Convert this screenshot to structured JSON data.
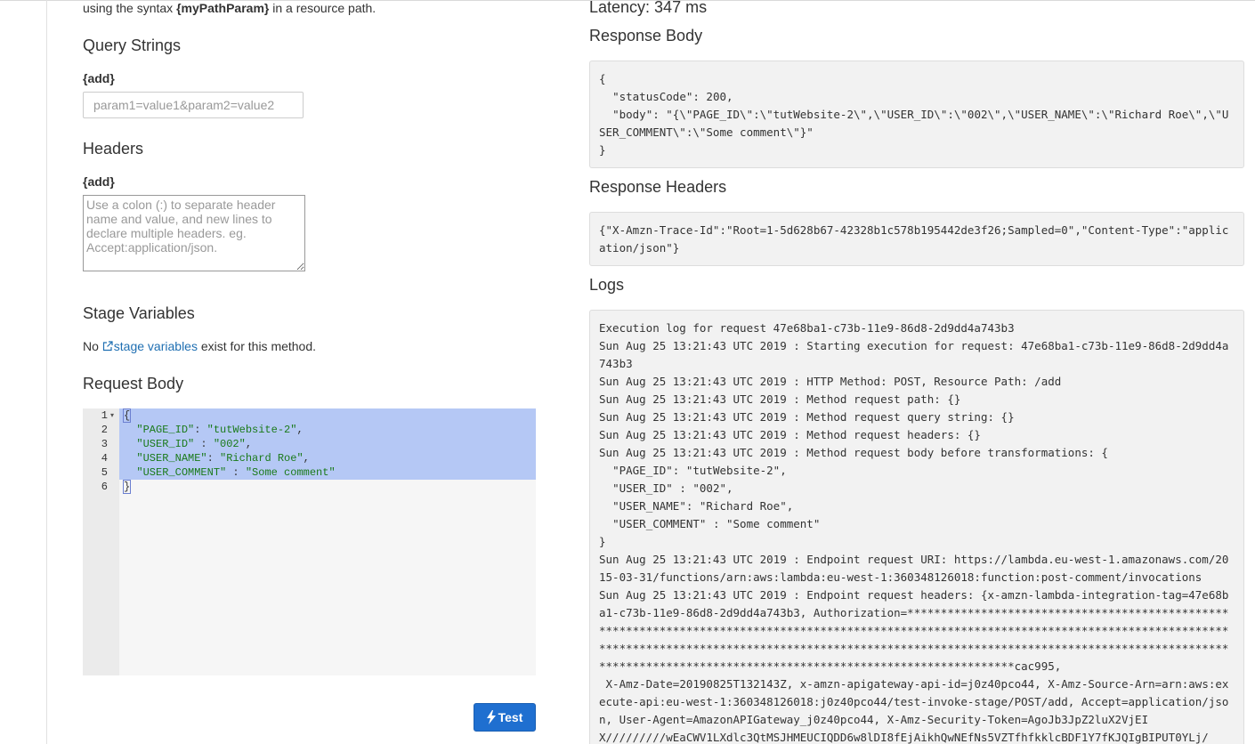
{
  "left": {
    "intro_pre": "using the syntax ",
    "intro_bold": "{myPathParam}",
    "intro_post": " in a resource path.",
    "query_strings": {
      "heading": "Query Strings",
      "add_label": "{add}",
      "placeholder": "param1=value1&param2=value2"
    },
    "headers": {
      "heading": "Headers",
      "add_label": "{add}",
      "placeholder": "Use a colon (:) to separate header name and value, and new lines to declare multiple headers. eg. Accept:application/json."
    },
    "stage_variables": {
      "heading": "Stage Variables",
      "text_pre": "No ",
      "link": "stage variables",
      "text_post": " exist for this method."
    },
    "request_body": {
      "heading": "Request Body",
      "line_numbers": [
        "1",
        "2",
        "3",
        "4",
        "5",
        "6"
      ],
      "lines": [
        {
          "pre": "{",
          "key": "",
          "mid": "",
          "val": "",
          "post": ""
        },
        {
          "pre": "  ",
          "key": "\"PAGE_ID\"",
          "mid": ": ",
          "val": "\"tutWebsite-2\"",
          "post": ","
        },
        {
          "pre": "  ",
          "key": "\"USER_ID\"",
          "mid": " : ",
          "val": "\"002\"",
          "post": ","
        },
        {
          "pre": "  ",
          "key": "\"USER_NAME\"",
          "mid": ": ",
          "val": "\"Richard Roe\"",
          "post": ","
        },
        {
          "pre": "  ",
          "key": "\"USER_COMMENT\"",
          "mid": " : ",
          "val": "\"Some comment\"",
          "post": ""
        },
        {
          "pre": "}",
          "key": "",
          "mid": "",
          "val": "",
          "post": ""
        }
      ]
    },
    "test_button": "Test"
  },
  "right": {
    "latency": "Latency: 347 ms",
    "response_body": {
      "heading": "Response Body",
      "content": "{\n  \"statusCode\": 200,\n  \"body\": \"{\\\"PAGE_ID\\\":\\\"tutWebsite-2\\\",\\\"USER_ID\\\":\\\"002\\\",\\\"USER_NAME\\\":\\\"Richard Roe\\\",\\\"USER_COMMENT\\\":\\\"Some comment\\\"}\"\n}"
    },
    "response_headers": {
      "heading": "Response Headers",
      "content": "{\"X-Amzn-Trace-Id\":\"Root=1-5d628b67-42328b1c578b195442de3f26;Sampled=0\",\"Content-Type\":\"application/json\"}"
    },
    "logs": {
      "heading": "Logs",
      "content": "Execution log for request 47e68ba1-c73b-11e9-86d8-2d9dd4a743b3\nSun Aug 25 13:21:43 UTC 2019 : Starting execution for request: 47e68ba1-c73b-11e9-86d8-2d9dd4a743b3\nSun Aug 25 13:21:43 UTC 2019 : HTTP Method: POST, Resource Path: /add\nSun Aug 25 13:21:43 UTC 2019 : Method request path: {}\nSun Aug 25 13:21:43 UTC 2019 : Method request query string: {}\nSun Aug 25 13:21:43 UTC 2019 : Method request headers: {}\nSun Aug 25 13:21:43 UTC 2019 : Method request body before transformations: {\n  \"PAGE_ID\": \"tutWebsite-2\",\n  \"USER_ID\" : \"002\",\n  \"USER_NAME\": \"Richard Roe\",\n  \"USER_COMMENT\" : \"Some comment\"\n}\nSun Aug 25 13:21:43 UTC 2019 : Endpoint request URI: https://lambda.eu-west-1.amazonaws.com/2015-03-31/functions/arn:aws:lambda:eu-west-1:360348126018:function:post-comment/invocations\nSun Aug 25 13:21:43 UTC 2019 : Endpoint request headers: {x-amzn-lambda-integration-tag=47e68ba1-c73b-11e9-86d8-2d9dd4a743b3, Authorization=**********************************************************************************************************************************************************************************************************************************************************************************************************cac995,\n X-Amz-Date=20190825T132143Z, x-amzn-apigateway-api-id=j0z40pco44, X-Amz-Source-Arn=arn:aws:execute-api:eu-west-1:360348126018:j0z40pco44/test-invoke-stage/POST/add, Accept=application/json, User-Agent=AmazonAPIGateway_j0z40pco44, X-Amz-Security-Token=AgoJb3JpZ2luX2VjEI\nX/////////wEaCWV1LXdlc3QtMSJHMEUCIQDD6w8lDI8fEjAikhQwNEfNs5VZTfhfkklcBDF1Y7fKJQIgBIPUT0YLj/"
    }
  },
  "colors": {
    "accent": "#1f6fd0",
    "link": "#1f6fb2",
    "selection": "#b5c8f5",
    "panel_bg": "#f2f2f2",
    "string": "#1a7a1a"
  }
}
